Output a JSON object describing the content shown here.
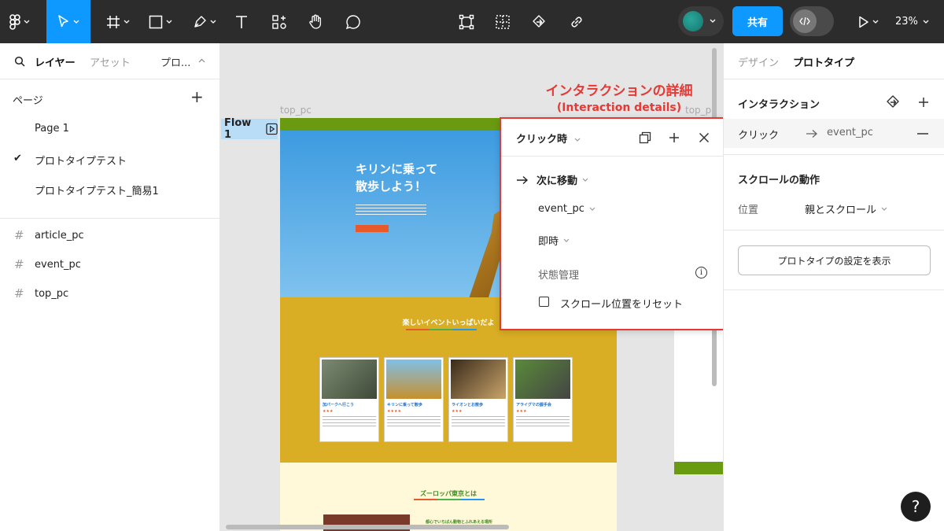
{
  "toolbar": {
    "share_label": "共有",
    "zoom": "23%",
    "avatar_color": "#1f8f86"
  },
  "left_panel": {
    "tab_layers": "レイヤー",
    "tab_assets": "アセット",
    "tab_page": "プロ...",
    "pages_heading": "ページ",
    "pages": [
      {
        "label": "Page 1",
        "current": false
      },
      {
        "label": "プロトタイプテスト",
        "current": true
      },
      {
        "label": "プロトタイプテスト_簡易1",
        "current": false
      }
    ],
    "frames": [
      {
        "label": "article_pc"
      },
      {
        "label": "event_pc"
      },
      {
        "label": "top_pc"
      }
    ]
  },
  "canvas": {
    "frame_label": "top_pc",
    "frame_label_2": "top_pc",
    "flow_label": "Flow 1",
    "site": {
      "hero_title": "キリンに乗って\n散歩しよう！",
      "events_title": "楽しいイベントいっぱいだよ",
      "cards": [
        {
          "title": "加パークへ行こう",
          "stars": "★★★"
        },
        {
          "title": "キリンに乗って散歩",
          "stars": "★★★★"
        },
        {
          "title": "ライオンとお散歩",
          "stars": "★★★"
        },
        {
          "title": "アライグマの握手会",
          "stars": "★★★"
        }
      ],
      "about_title": "ズーロッパ東京とは",
      "about_sub": "都心でいちばん動物とふれあえる場所"
    }
  },
  "annotation": {
    "line1": "インタラクションの詳細",
    "line2": "(Interaction details)"
  },
  "interaction_popup": {
    "trigger": "クリック時",
    "action": "次に移動",
    "destination": "event_pc",
    "animation": "即時",
    "state_label": "状態管理",
    "reset_scroll_label": "スクロール位置をリセット",
    "reset_scroll_checked": false
  },
  "right_panel": {
    "tab_design": "デザイン",
    "tab_prototype": "プロトタイプ",
    "interaction_heading": "インタラクション",
    "interaction_trigger": "クリック",
    "interaction_target": "event_pc",
    "scroll_heading": "スクロールの動作",
    "position_label": "位置",
    "position_value": "親とスクロール",
    "proto_settings_button": "プロトタイプの設定を表示"
  },
  "colors": {
    "accent": "#0d99ff",
    "annotation": "#e53935",
    "toolbar_bg": "#2c2c2c"
  }
}
